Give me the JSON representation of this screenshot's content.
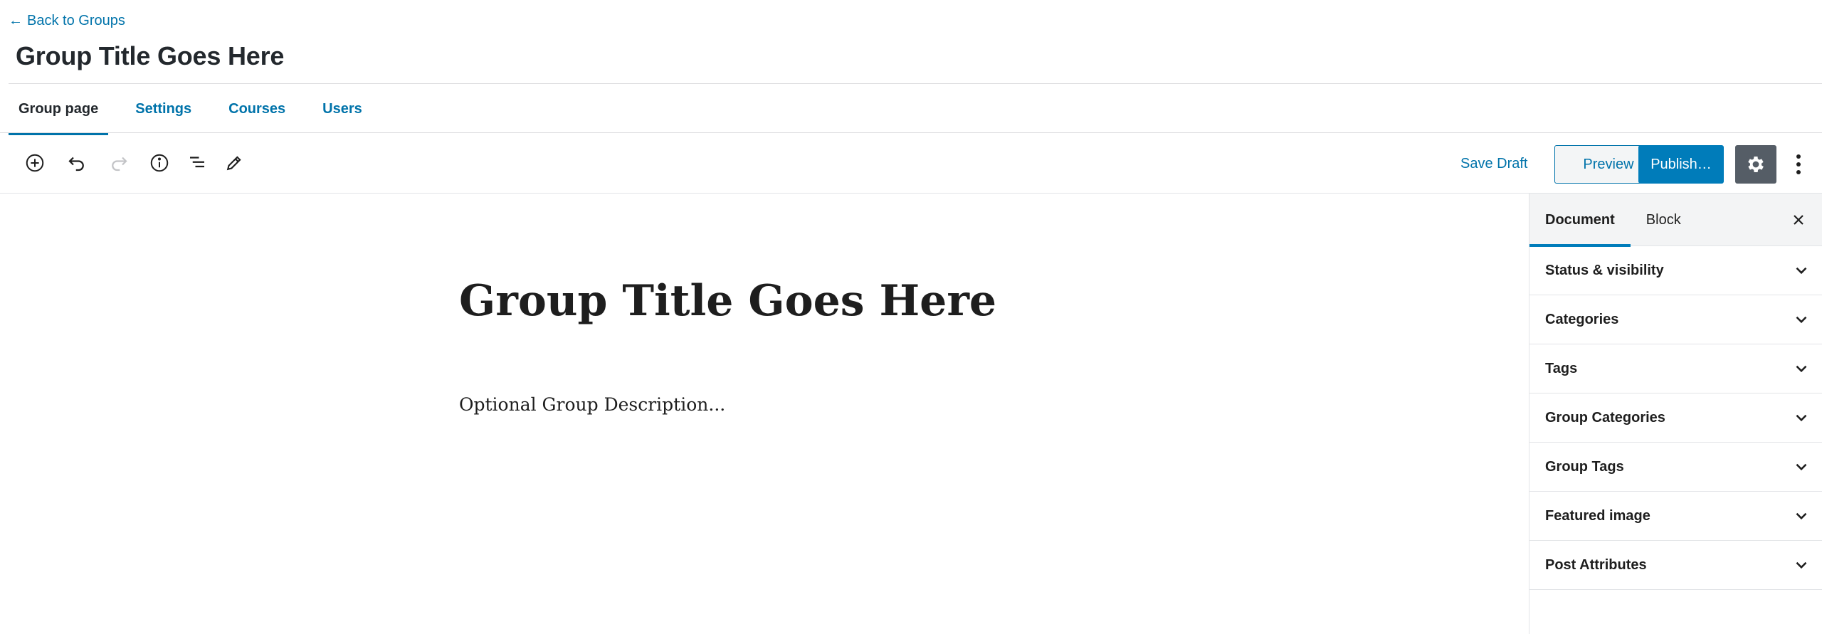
{
  "header": {
    "back_label": "Back to Groups",
    "title": "Group Title Goes Here"
  },
  "tabs": [
    {
      "label": "Group page",
      "active": true
    },
    {
      "label": "Settings",
      "active": false
    },
    {
      "label": "Courses",
      "active": false
    },
    {
      "label": "Users",
      "active": false
    }
  ],
  "toolbar": {
    "icons": [
      "add-block-icon",
      "undo-icon",
      "redo-icon",
      "info-icon",
      "outline-icon",
      "edit-tools-icon"
    ],
    "save_draft_label": "Save Draft",
    "preview_label": "Preview",
    "publish_label": "Publish…",
    "settings_icon": "gear-icon",
    "more_icon": "more-vertical-icon"
  },
  "editor": {
    "title": "Group Title Goes Here",
    "description_placeholder": "Optional Group Description..."
  },
  "sidebar": {
    "tabs": [
      {
        "label": "Document",
        "active": true
      },
      {
        "label": "Block",
        "active": false
      }
    ],
    "panels": [
      {
        "label": "Status & visibility"
      },
      {
        "label": "Categories"
      },
      {
        "label": "Tags"
      },
      {
        "label": "Group Categories"
      },
      {
        "label": "Group Tags"
      },
      {
        "label": "Featured image"
      },
      {
        "label": "Post Attributes"
      }
    ]
  },
  "colors": {
    "accent": "#0073aa",
    "primary_button": "#007cba",
    "settings_button": "#555d66",
    "text": "#1e1e1e"
  }
}
